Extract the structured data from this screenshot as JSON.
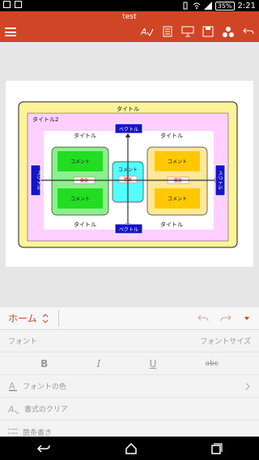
{
  "status_bar": {
    "battery": "35%",
    "time": "2:21"
  },
  "app_bar": {
    "document_title": "test",
    "menu_icon": "hamburger-menu-icon"
  },
  "slide": {
    "outer_title": "タイトル",
    "inner_title": "タイトル2",
    "top_left_title": "タイトル",
    "top_right_title": "タイトル",
    "bottom_left_title": "タイトル",
    "bottom_right_title": "タイトル",
    "vector_top": "ベクトル",
    "vector_bottom": "ベクトル",
    "vector_left": "ベクトル",
    "vector_right": "ベクトル",
    "left_comment_top": "コメント",
    "left_comment_bottom": "コメント",
    "left_element": "要素",
    "center_comment": "コメント",
    "center_element": "要素",
    "right_comment_top": "コメント",
    "right_comment_bottom": "コメント",
    "right_element": "要素"
  },
  "ribbon": {
    "tab_label": "ホーム",
    "font_label": "フォント",
    "font_size_label": "フォントサイズ",
    "bold": "B",
    "italic": "I",
    "underline": "U",
    "strike": "abc",
    "font_color_label": "フォントの色",
    "clear_format_label": "書式のクリア",
    "partial_next": "箇条書き"
  },
  "colors": {
    "accent": "#d04525",
    "outer_frame": "#fdf39a",
    "inner_frame": "#ffd0ff",
    "vector_blue": "#1414c8",
    "green": "#22dd22",
    "cyan": "#55ffff",
    "yellow": "#ffc800"
  }
}
